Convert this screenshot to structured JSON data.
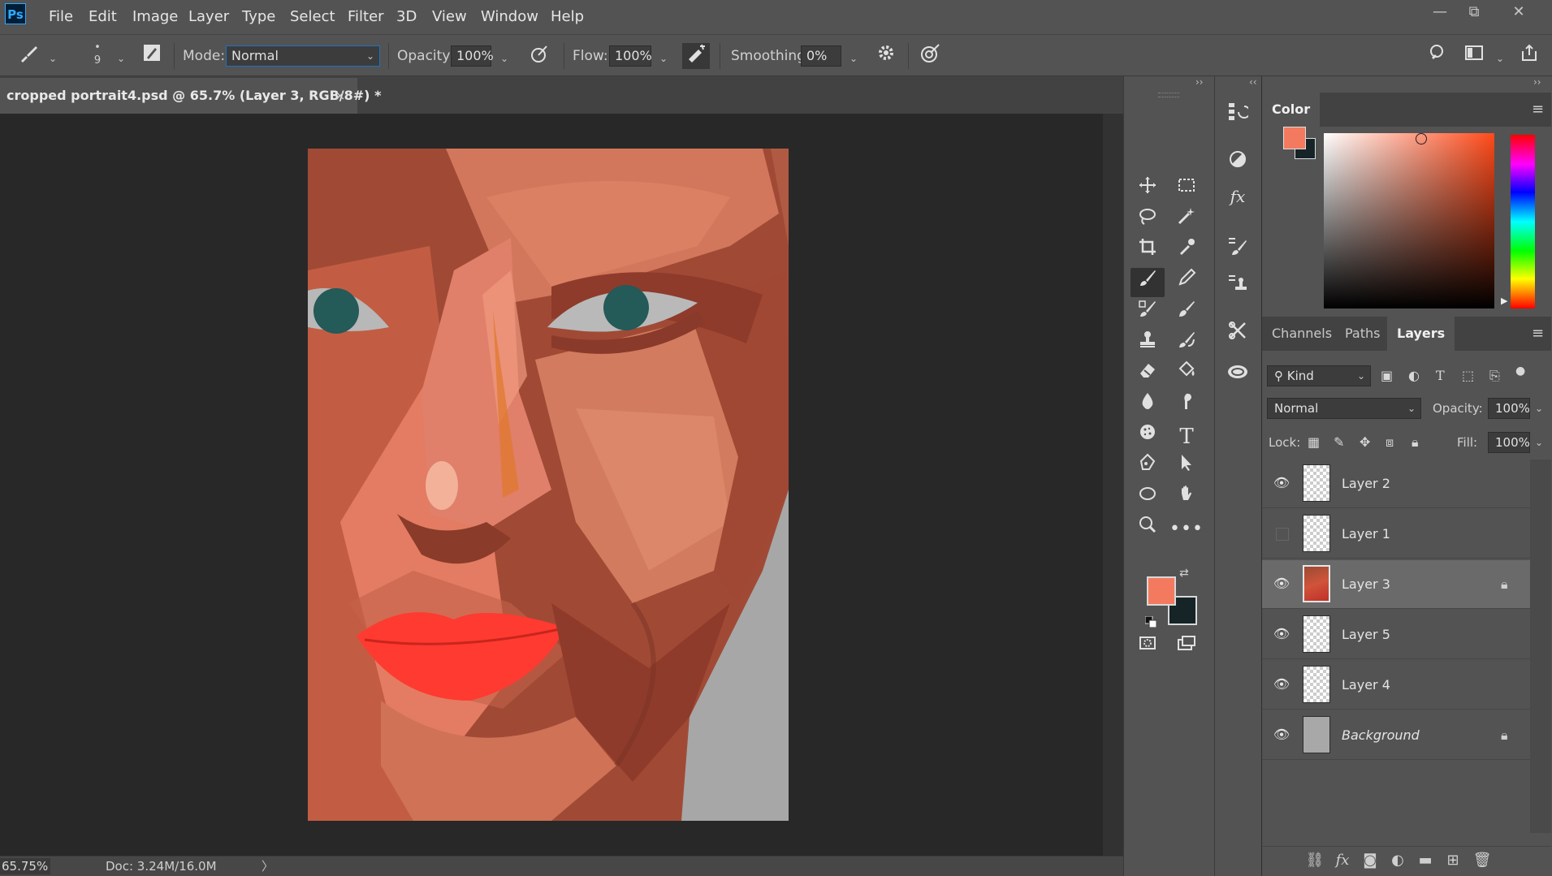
{
  "app": {
    "logo": "Ps"
  },
  "menu": [
    "File",
    "Edit",
    "Image",
    "Layer",
    "Type",
    "Select",
    "Filter",
    "3D",
    "View",
    "Window",
    "Help"
  ],
  "window_controls": {
    "minimize": "—",
    "restore": "⧉",
    "close": "✕"
  },
  "options": {
    "brush_size": "9",
    "mode_label": "Mode:",
    "mode_value": "Normal",
    "opacity_label": "Opacity:",
    "opacity_value": "100%",
    "flow_label": "Flow:",
    "flow_value": "100%",
    "smoothing_label": "Smoothing:",
    "smoothing_value": "0%"
  },
  "document": {
    "tab_title": "cropped portrait4.psd @ 65.7% (Layer 3, RGB/8#) *",
    "close": "×"
  },
  "status": {
    "zoom": "65.75%",
    "doc_info": "Doc: 3.24M/16.0M",
    "arrow": "〉"
  },
  "colors": {
    "foreground": "#f47a5f",
    "background": "#162428",
    "accent": "#31a8ff"
  },
  "color_panel": {
    "title": "Color"
  },
  "layers_panel": {
    "tabs": [
      "Channels",
      "Paths",
      "Layers"
    ],
    "active_tab": "Layers",
    "filter_label": "Kind",
    "blend_mode": "Normal",
    "opacity_label": "Opacity:",
    "opacity_value": "100%",
    "lock_label": "Lock:",
    "fill_label": "Fill:",
    "fill_value": "100%",
    "layers": [
      {
        "name": "Layer 2",
        "visible": true,
        "locked": false,
        "thumb": "transparent"
      },
      {
        "name": "Layer 1",
        "visible": false,
        "locked": false,
        "thumb": "transparent"
      },
      {
        "name": "Layer 3",
        "visible": true,
        "locked": true,
        "thumb": "face",
        "selected": true
      },
      {
        "name": "Layer 5",
        "visible": true,
        "locked": false,
        "thumb": "transparent"
      },
      {
        "name": "Layer 4",
        "visible": true,
        "locked": false,
        "thumb": "transparent"
      },
      {
        "name": "Background",
        "visible": true,
        "locked": true,
        "thumb": "gray",
        "italic": true
      }
    ]
  },
  "tools": [
    "move-icon",
    "marquee-icon",
    "lasso-icon",
    "magic-wand-icon",
    "crop-icon",
    "eyedropper-icon",
    "brush-icon",
    "pencil-icon",
    "healing-icon",
    "mixer-brush-icon",
    "stamp-icon",
    "history-brush-icon",
    "eraser-icon",
    "paint-bucket-icon",
    "blur-icon",
    "smudge-icon",
    "sponge-icon",
    "type-icon",
    "pen-icon",
    "path-select-icon",
    "ellipse-icon",
    "hand-icon",
    "zoom-icon",
    "more-icon"
  ]
}
